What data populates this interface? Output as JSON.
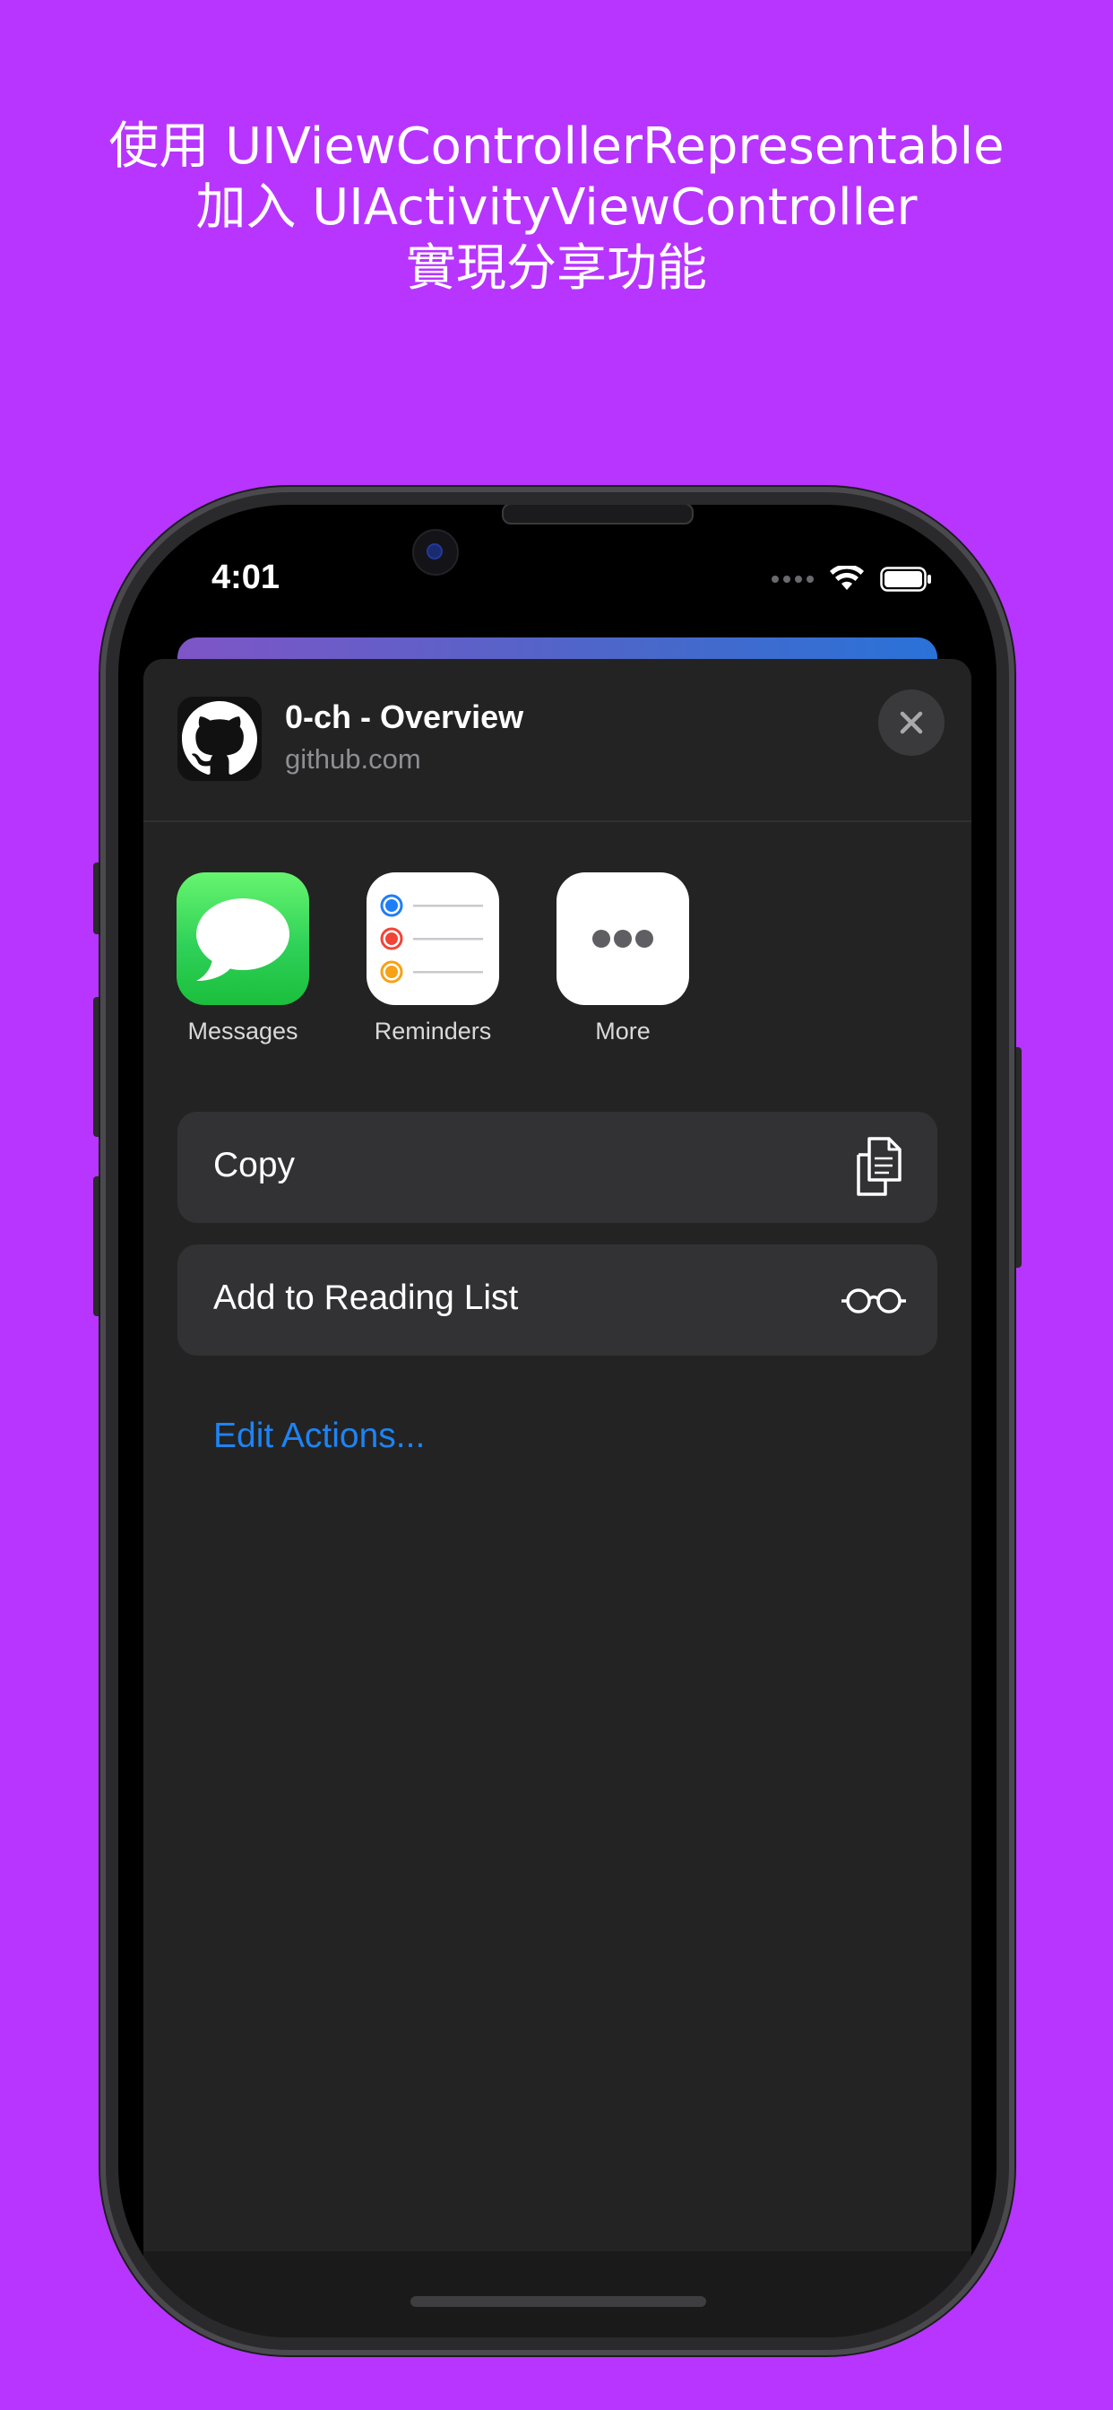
{
  "promo": {
    "line1": "使用 UIViewControllerRepresentable",
    "line2": "加入 UIActivityViewController",
    "line3": "實現分享功能"
  },
  "status_bar": {
    "time": "4:01"
  },
  "share_sheet": {
    "title": "0-ch - Overview",
    "subtitle": "github.com",
    "apps": [
      {
        "label": "Messages",
        "icon": "messages-icon"
      },
      {
        "label": "Reminders",
        "icon": "reminders-icon"
      },
      {
        "label": "More",
        "icon": "more-icon"
      }
    ],
    "actions": [
      {
        "label": "Copy",
        "icon": "copy-icon"
      },
      {
        "label": "Add to Reading List",
        "icon": "glasses-icon"
      }
    ],
    "edit_actions": "Edit Actions..."
  },
  "colors": {
    "background": "#B735FF",
    "sheet": "#232323",
    "action_row": "#323234",
    "link": "#1D84F5",
    "messages_green": "#2FD158"
  }
}
